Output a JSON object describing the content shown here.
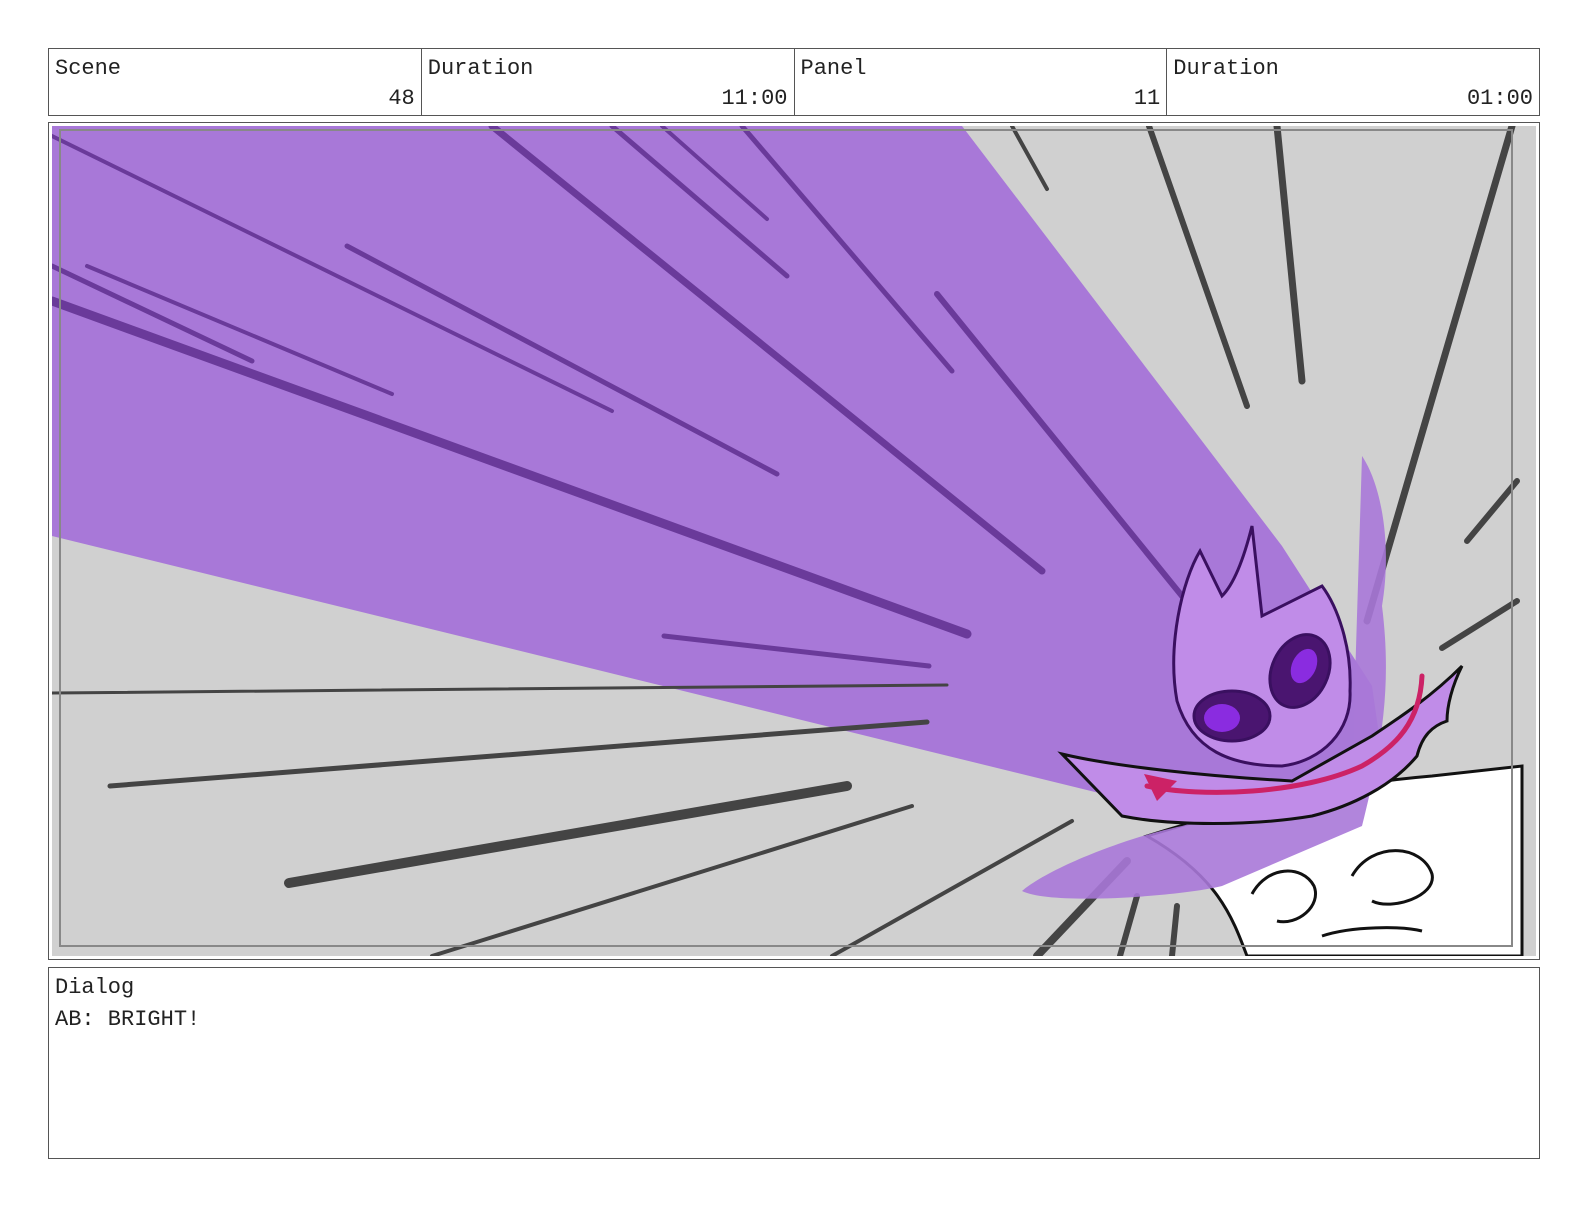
{
  "header": {
    "scene_label": "Scene",
    "scene_value": "48",
    "scene_duration_label": "Duration",
    "scene_duration_value": "11:00",
    "panel_label": "Panel",
    "panel_value": "11",
    "panel_duration_label": "Duration",
    "panel_duration_value": "01:00"
  },
  "dialog": {
    "label": "Dialog",
    "text": "AB: BRIGHT!"
  },
  "colors": {
    "beam": "#a878d8",
    "background_gray": "#d0d0d0",
    "speed_line": "#444444",
    "character_purple": "#c08ce8",
    "eye_dark": "#4a1570",
    "tongue": "#cc2266"
  }
}
